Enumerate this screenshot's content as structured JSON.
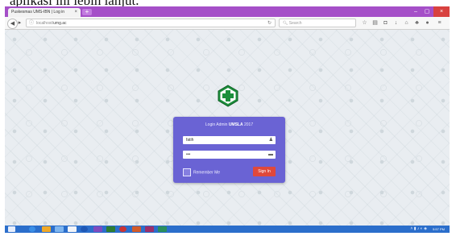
{
  "caption": {
    "text": "aplikasi ini lebih lanjut."
  },
  "browser": {
    "tab_title": "Puskesmas UMS-IBN | Log in",
    "tab_close": "×",
    "new_tab": "+",
    "url_prefix": "localhost/",
    "url": "umg.ac",
    "search_placeholder": "Search",
    "window_controls": {
      "minimize": "–",
      "maximize": "▢",
      "close": "×"
    }
  },
  "login": {
    "title_prefix": "Login Admin ",
    "title_bold": "UMSLA",
    "title_suffix": " 2017",
    "username_value": "fatih",
    "password_value": "•••",
    "remember_label": "Remember Me",
    "signin_label": "Sign In"
  },
  "taskbar": {
    "clock": "5:57 PM"
  },
  "colors": {
    "titlebar": "#a54fc8",
    "login_panel": "#6a63d4",
    "signin_button": "#e0483b",
    "taskbar": "#2b6ecb",
    "logo_green": "#1c8f3c"
  }
}
